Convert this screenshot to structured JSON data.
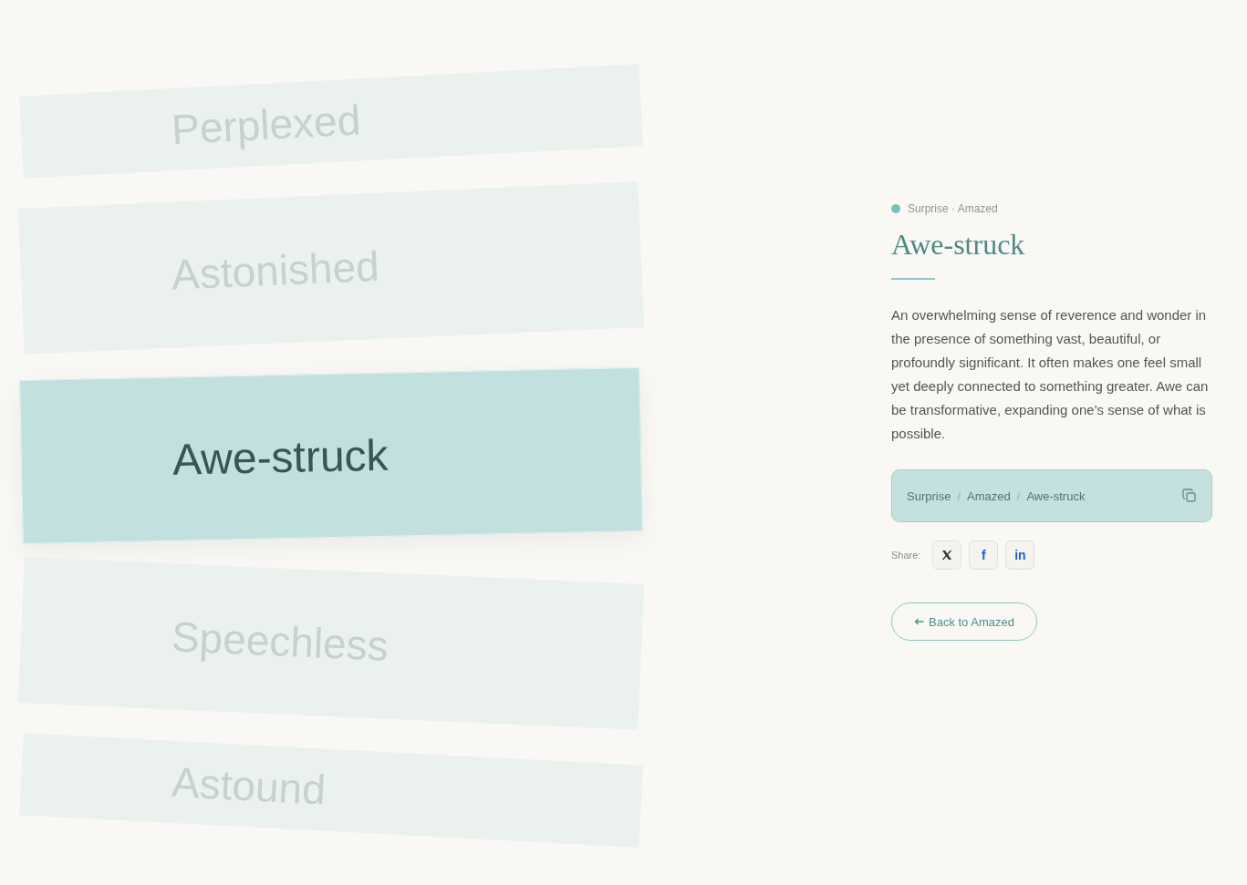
{
  "wheel": {
    "items": [
      {
        "label": "Perplexed",
        "selected": false
      },
      {
        "label": "Astonished",
        "selected": false
      },
      {
        "label": "Awe-struck",
        "selected": true
      },
      {
        "label": "Speechless",
        "selected": false
      },
      {
        "label": "Astound",
        "selected": false
      }
    ]
  },
  "detail": {
    "category": "Surprise · Amazed",
    "title": "Awe-struck",
    "description": "An overwhelming sense of reverence and wonder in the presence of something vast, beautiful, or profoundly significant. It often makes one feel small yet deeply connected to something greater. Awe can be transformative, expanding one's sense of what is possible.",
    "path": [
      "Surprise",
      "Amazed",
      "Awe-struck"
    ],
    "path_separator": "/",
    "share_label": "Share:",
    "share": [
      {
        "kind": "x"
      },
      {
        "kind": "text",
        "label": "f"
      },
      {
        "kind": "text",
        "label": "in"
      }
    ],
    "back_button": "Back to Amazed"
  }
}
